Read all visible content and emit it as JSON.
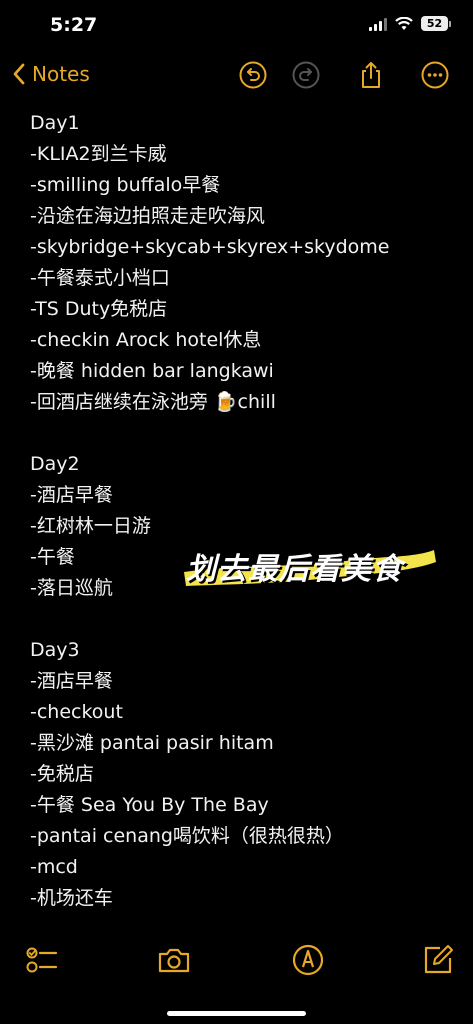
{
  "status": {
    "time": "5:27",
    "battery": "52"
  },
  "nav": {
    "back_label": "Notes",
    "accent_color": "#e6a828",
    "icons": [
      "undo-icon",
      "redo-icon",
      "share-icon",
      "more-icon"
    ]
  },
  "note": {
    "lines": [
      "Day1",
      "-KLIA2到兰卡威",
      "-smilling buffalo早餐",
      "-沿途在海边拍照走走吹海风",
      "-skybridge+skycab+skyrex+skydome",
      "-午餐泰式小档口",
      "-TS Duty免税店",
      "-checkin Arock hotel休息",
      "-晚餐 hidden bar langkawi",
      "-回酒店继续在泳池旁 🍺chill",
      "",
      "Day2",
      "-酒店早餐",
      "-红树林一日游",
      "-午餐",
      "-落日巡航",
      "",
      "Day3",
      "-酒店早餐",
      "-checkout",
      "-黑沙滩 pantai pasir hitam",
      "-免税店",
      "-午餐 Sea You By The Bay",
      "-pantai cenang喝饮料（很热很热）",
      "-mcd",
      "-机场还车"
    ]
  },
  "sticker": {
    "text": "划去最后看美食",
    "highlight_color": "#f2e44a"
  },
  "toolbar": {
    "icons": [
      "checklist-icon",
      "camera-icon",
      "markup-icon",
      "compose-icon"
    ]
  }
}
